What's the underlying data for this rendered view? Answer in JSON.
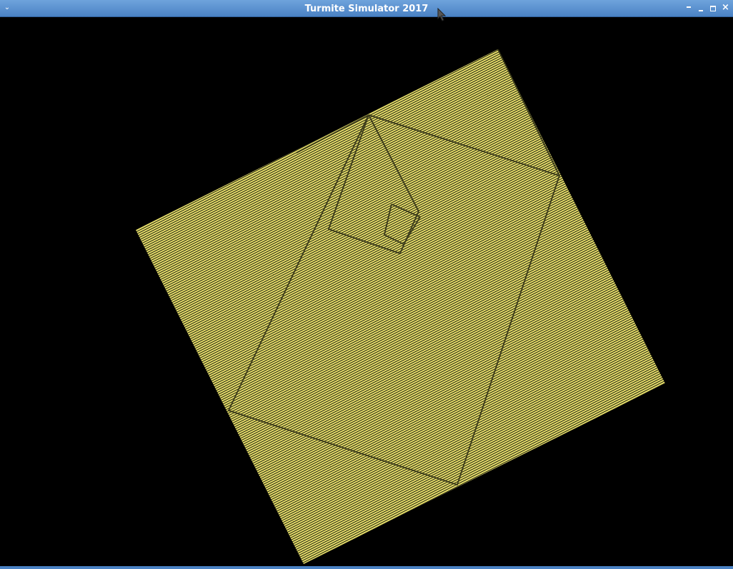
{
  "window": {
    "title": "Turmite Simulator 2017",
    "menu_icon": "chevron-down-icon",
    "controls": [
      "shade-icon",
      "minimize-icon",
      "maximize-icon",
      "close-icon"
    ]
  },
  "simulation": {
    "background_color": "#000000",
    "pattern_color": "#e8e06a",
    "line_color": "#1a1a10"
  },
  "colors": {
    "titlebar": "#5a92d2",
    "title_text": "#ffffff"
  }
}
